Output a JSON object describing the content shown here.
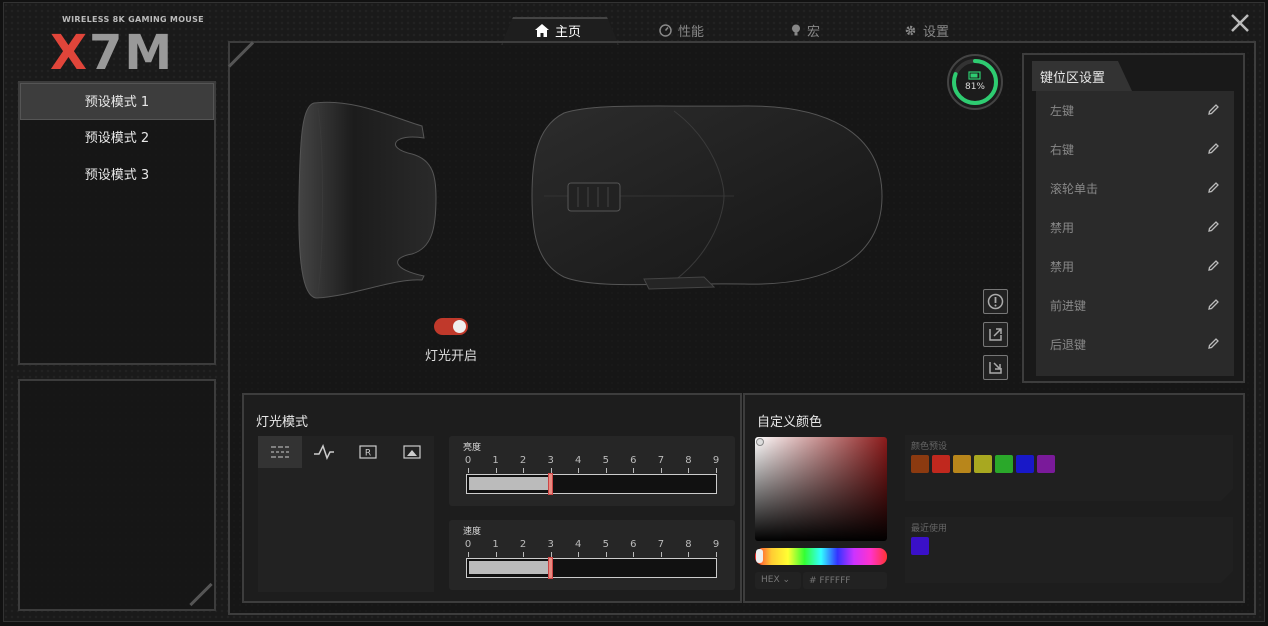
{
  "logo": {
    "subtitle": "WIRELESS 8K GAMING MOUSE",
    "x": "X",
    "rest": "7M"
  },
  "presets": [
    {
      "label": "预设模式 1",
      "active": true
    },
    {
      "label": "预设模式 2",
      "active": false
    },
    {
      "label": "预设模式 3",
      "active": false
    }
  ],
  "tabs": [
    {
      "label": "主页",
      "icon": "home-icon",
      "active": true
    },
    {
      "label": "性能",
      "icon": "gauge-icon",
      "active": false
    },
    {
      "label": "宏",
      "icon": "bulb-icon",
      "active": false
    },
    {
      "label": "设置",
      "icon": "gear-icon",
      "active": false
    }
  ],
  "battery": {
    "label": "81%",
    "level": 0.81,
    "color": "#2ecc71"
  },
  "light": {
    "label": "灯光开启",
    "on": true,
    "toggle_color": "#c0392b"
  },
  "key_settings": {
    "title": "键位区设置",
    "keys": [
      "左键",
      "右键",
      "滚轮单击",
      "禁用",
      "禁用",
      "前进键",
      "后退键"
    ]
  },
  "light_mode": {
    "title": "灯光模式",
    "modes": [
      "lines-mode-icon",
      "pulse-mode-icon",
      "r-mode-icon",
      "image-mode-icon"
    ],
    "brightness": {
      "label": "亮度",
      "ticks": [
        "0",
        "1",
        "2",
        "3",
        "4",
        "5",
        "6",
        "7",
        "8",
        "9"
      ],
      "value": 3
    },
    "speed": {
      "label": "速度",
      "ticks": [
        "0",
        "1",
        "2",
        "3",
        "4",
        "5",
        "6",
        "7",
        "8",
        "9"
      ],
      "value": 3
    }
  },
  "custom_color": {
    "title": "自定义颜色",
    "hex_mode": "HEX",
    "hex_placeholder": "# FFFFFF",
    "presets_label": "颜色预设",
    "preset_colors": [
      "#8b3a10",
      "#c0281e",
      "#b8861b",
      "#a8a820",
      "#2aa82a",
      "#1818c8",
      "#7a1a9a"
    ],
    "recent_label": "最近使用",
    "recent_colors": [
      "#3a10c8"
    ]
  }
}
